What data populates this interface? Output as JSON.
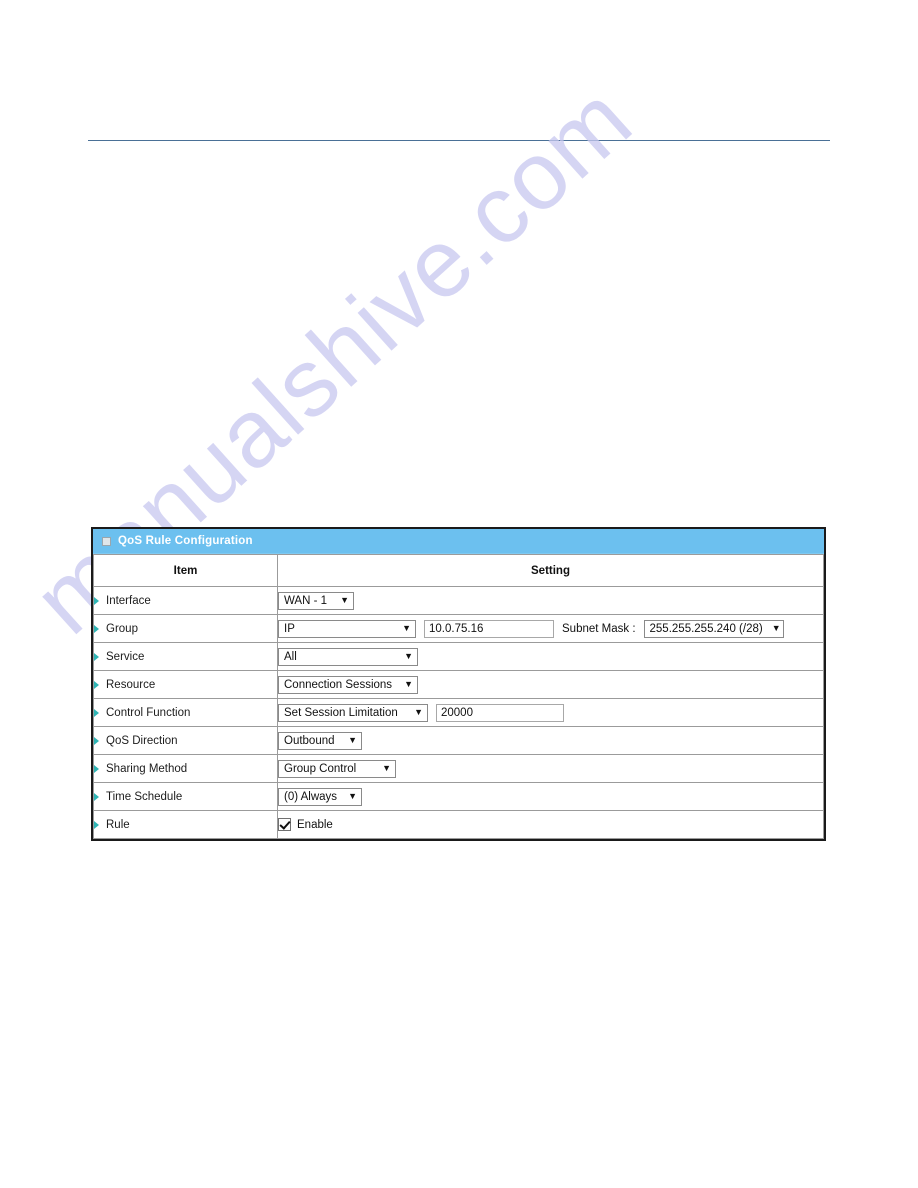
{
  "page": {
    "watermark": "manualshive.com",
    "divider_color": "#4a7096"
  },
  "panel": {
    "title": "QoS Rule Configuration",
    "title_icon": "window-square-icon",
    "accent_color": "#6cc0ef",
    "columns": {
      "item": "Item",
      "setting": "Setting"
    },
    "rows": [
      {
        "label": "Interface",
        "controls": [
          {
            "kind": "select",
            "name": "interface-select",
            "value": "WAN - 1"
          }
        ]
      },
      {
        "label": "Group",
        "controls": [
          {
            "kind": "select",
            "name": "group-type-select",
            "value": "IP"
          },
          {
            "kind": "text",
            "name": "group-ip-input",
            "value": "10.0.75.16"
          },
          {
            "kind": "label",
            "name": "subnet-mask-label",
            "value": "Subnet Mask :"
          },
          {
            "kind": "select",
            "name": "subnet-mask-select",
            "value": "255.255.255.240 (/28)"
          }
        ]
      },
      {
        "label": "Service",
        "controls": [
          {
            "kind": "select",
            "name": "service-select",
            "value": "All"
          }
        ]
      },
      {
        "label": "Resource",
        "controls": [
          {
            "kind": "select",
            "name": "resource-select",
            "value": "Connection Sessions"
          }
        ]
      },
      {
        "label": "Control Function",
        "controls": [
          {
            "kind": "select",
            "name": "control-function-select",
            "value": "Set Session Limitation"
          },
          {
            "kind": "text",
            "name": "session-limit-input",
            "value": "20000"
          }
        ]
      },
      {
        "label": "QoS Direction",
        "controls": [
          {
            "kind": "select",
            "name": "qos-direction-select",
            "value": "Outbound"
          }
        ]
      },
      {
        "label": "Sharing Method",
        "controls": [
          {
            "kind": "select",
            "name": "sharing-method-select",
            "value": "Group Control"
          }
        ]
      },
      {
        "label": "Time Schedule",
        "controls": [
          {
            "kind": "select",
            "name": "time-schedule-select",
            "value": "(0) Always"
          }
        ]
      },
      {
        "label": "Rule",
        "controls": [
          {
            "kind": "checkbox",
            "name": "rule-enable-checkbox",
            "value": "Enable",
            "checked": true
          }
        ]
      }
    ]
  }
}
